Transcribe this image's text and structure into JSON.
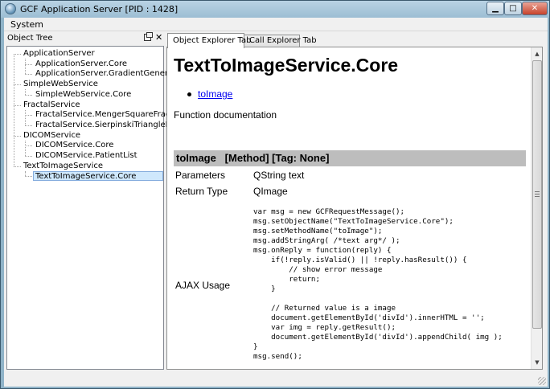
{
  "window": {
    "title": "GCF Application Server [PID : 1428]",
    "min_glyph": "▁",
    "max_glyph": "□",
    "close_glyph": "✕"
  },
  "menu": {
    "system": "System"
  },
  "dock": {
    "title": "Object Tree",
    "close_glyph": "✕",
    "tree": [
      {
        "label": "ApplicationServer",
        "level": 0
      },
      {
        "label": "ApplicationServer.Core",
        "level": 1
      },
      {
        "label": "ApplicationServer.GradientGenerator",
        "level": 1
      },
      {
        "label": "SimpleWebService",
        "level": 0
      },
      {
        "label": "SimpleWebService.Core",
        "level": 1
      },
      {
        "label": "FractalService",
        "level": 0
      },
      {
        "label": "FractalService.MengerSquareFractal",
        "level": 1
      },
      {
        "label": "FractalService.SierpinskiTriangleFractal",
        "level": 1
      },
      {
        "label": "DICOMService",
        "level": 0
      },
      {
        "label": "DICOMService.Core",
        "level": 1
      },
      {
        "label": "DICOMService.PatientList",
        "level": 1
      },
      {
        "label": "TextToImageService",
        "level": 0
      },
      {
        "label": "TextToImageService.Core",
        "level": 1,
        "selected": true
      }
    ]
  },
  "tabs": {
    "object_explorer": "Object Explorer Tab",
    "call_explorer": "Call Explorer Tab"
  },
  "doc": {
    "title": "TextToImageService.Core",
    "method_link": "toImage",
    "function_doc": "Function documentation",
    "method_header": "toImage   [Method] [Tag: None]",
    "params_label": "Parameters",
    "params_value": "QString text",
    "return_label": "Return Type",
    "return_value": "QImage",
    "ajax_label": "AJAX Usage",
    "code": "var msg = new GCFRequestMessage();\nmsg.setObjectName(\"TextToImageService.Core\");\nmsg.setMethodName(\"toImage\");\nmsg.addStringArg( /*text arg*/ );\nmsg.onReply = function(reply) {\n    if(!reply.isValid() || !reply.hasResult()) {\n        // show error message\n        return;\n    }\n\n    // Returned value is a image\n    document.getElementById('divId').innerHTML = '';\n    var img = reply.getResult();\n    document.getElementById('divId').appendChild( img );\n}\nmsg.send();"
  },
  "scrollbar": {
    "up_glyph": "▲",
    "down_glyph": "▼"
  }
}
